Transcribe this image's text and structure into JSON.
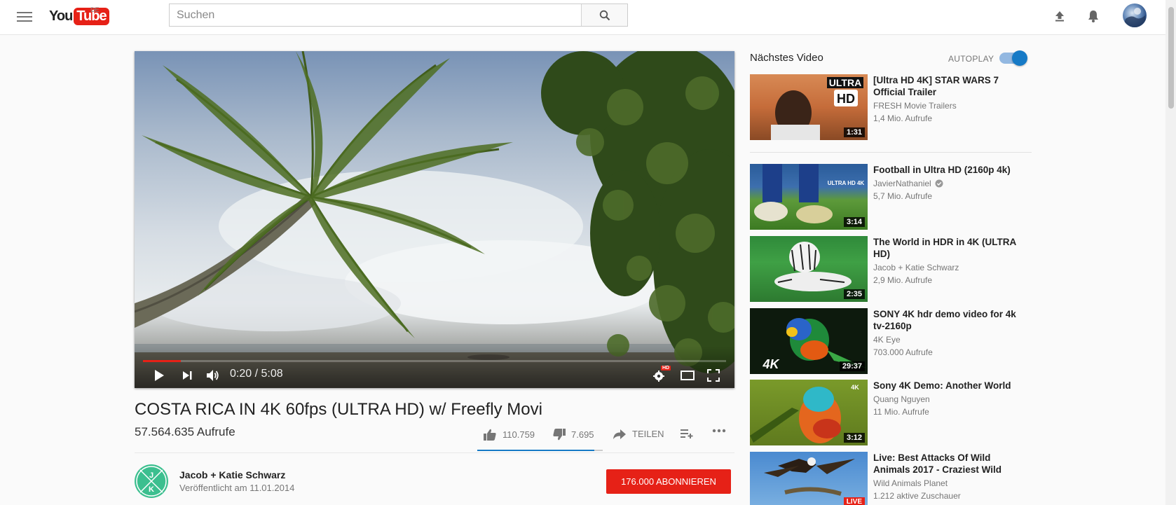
{
  "header": {
    "logo_you": "You",
    "logo_tube": "Tube",
    "logo_country": "DE",
    "search_placeholder": "Suchen",
    "icons": [
      "menu-icon",
      "search-icon",
      "upload-icon",
      "bell-icon",
      "avatar"
    ]
  },
  "player": {
    "time_current": "0:20",
    "time_total": "5:08",
    "progress": 0.065,
    "hd_badge": "HD"
  },
  "video": {
    "title": "COSTA RICA IN 4K 60fps (ULTRA HD) w/ Freefly Movi",
    "views": "57.564.635 Aufrufe",
    "likes": "110.759",
    "dislikes": "7.695",
    "share_label": "TEILEN",
    "like_ratio": 0.935
  },
  "channel": {
    "name": "Jacob + Katie Schwarz",
    "published": "Veröffentlicht am 11.01.2014",
    "subscribe_label": "176.000 ABONNIEREN",
    "avatar_letters": [
      "J",
      "K"
    ]
  },
  "sidebar": {
    "next_label": "Nächstes Video",
    "autoplay_label": "AUTOPLAY",
    "autoplay_on": true,
    "videos": [
      {
        "title": "[Ultra HD 4K] STAR WARS 7 Official Trailer",
        "channel": "FRESH Movie Trailers",
        "views": "1,4 Mio. Aufrufe",
        "duration": "1:31",
        "badge": "ULTRA HD"
      },
      {
        "title": "Football in Ultra HD (2160p 4k)",
        "channel": "JavierNathaniel",
        "views": "5,7 Mio. Aufrufe",
        "duration": "3:14",
        "verified": true,
        "badge": "ULTRA HD 4K"
      },
      {
        "title": "The World in HDR in 4K (ULTRA HD)",
        "channel": "Jacob + Katie Schwarz",
        "views": "2,9 Mio. Aufrufe",
        "duration": "2:35"
      },
      {
        "title": "SONY 4K hdr demo video for 4k tv-2160p",
        "channel": "4K Eye",
        "views": "703.000 Aufrufe",
        "duration": "29:37",
        "badge": "4K"
      },
      {
        "title": "Sony 4K Demo: Another World",
        "channel": "Quang Nguyen",
        "views": "11 Mio. Aufrufe",
        "duration": "3:12",
        "badge": "4K"
      },
      {
        "title": "Live: Best Attacks Of Wild Animals 2017 - Craziest Wild",
        "channel": "Wild Animals Planet",
        "views": "1.212 aktive Zuschauer",
        "badge": "LIVE"
      }
    ]
  }
}
